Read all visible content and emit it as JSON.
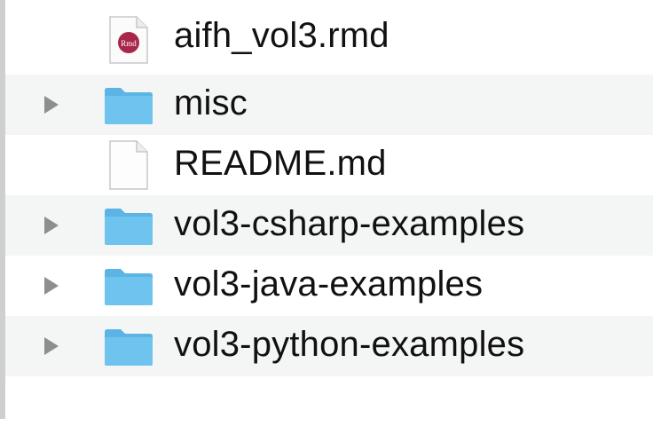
{
  "colors": {
    "folder": "#6fc3ef",
    "folder_tab": "#5bb4e4",
    "stripe": "#f4f5f5",
    "triangle": "#8e8e8e",
    "rmd_badge": "#a8264a"
  },
  "files": [
    {
      "name": "aifh_vol3.rmd",
      "icon": "rmd-file-icon",
      "expandable": false
    },
    {
      "name": "misc",
      "icon": "folder-icon",
      "expandable": true
    },
    {
      "name": "README.md",
      "icon": "document-icon",
      "expandable": false
    },
    {
      "name": "vol3-csharp-examples",
      "icon": "folder-icon",
      "expandable": true
    },
    {
      "name": "vol3-java-examples",
      "icon": "folder-icon",
      "expandable": true
    },
    {
      "name": "vol3-python-examples",
      "icon": "folder-icon",
      "expandable": true
    }
  ]
}
